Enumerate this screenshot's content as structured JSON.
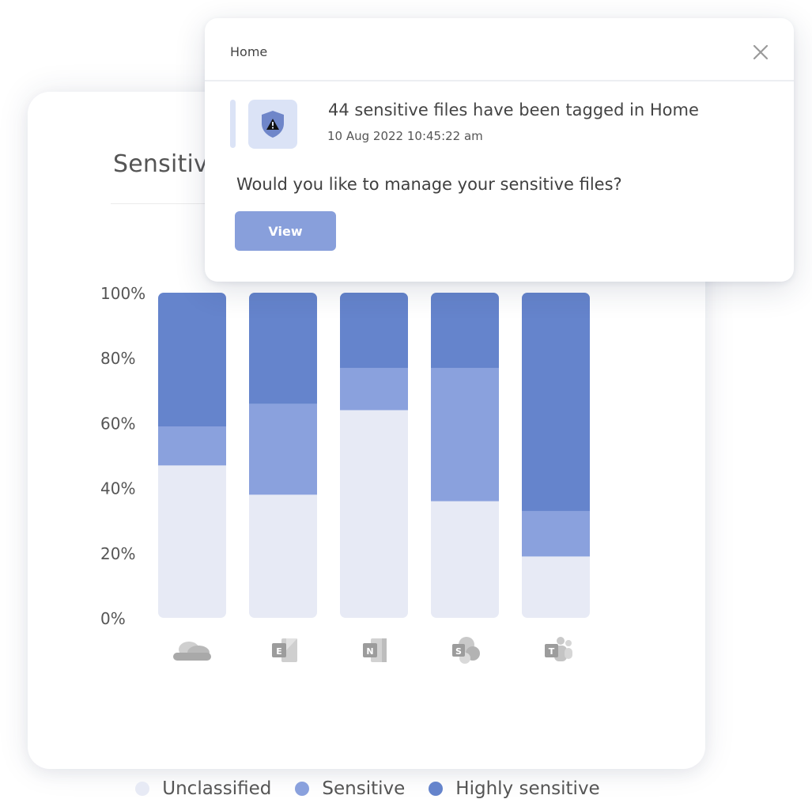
{
  "card": {
    "title": "Sensitive"
  },
  "popup": {
    "title": "Home",
    "message": "44 sensitive files have been tagged in Home",
    "timestamp": "10 Aug 2022  10:45:22 am",
    "question": "Would you like to manage your sensitive files?",
    "view_label": "View"
  },
  "colors": {
    "unclassified": "#e7eaf5",
    "sensitive": "#8aa1dd",
    "highly_sensitive": "#6584cc",
    "icon_gray": "#b9b9b9"
  },
  "chart_data": {
    "type": "bar",
    "stacked": true,
    "categories": [
      "onedrive-icon",
      "exchange-icon",
      "onenote-icon",
      "sharepoint-icon",
      "teams-icon"
    ],
    "category_letters": [
      "",
      "E",
      "N",
      "S",
      "T"
    ],
    "series": [
      {
        "name": "Unclassified",
        "values": [
          47,
          38,
          64,
          36,
          19
        ]
      },
      {
        "name": "Sensitive",
        "values": [
          12,
          28,
          13,
          41,
          14
        ]
      },
      {
        "name": "Highly sensitive",
        "values": [
          41,
          34,
          23,
          23,
          67
        ]
      }
    ],
    "yticks": [
      "100%",
      "80%",
      "60%",
      "40%",
      "20%",
      "0%"
    ],
    "ylim": [
      0,
      100
    ],
    "legend_position": "bottom"
  }
}
